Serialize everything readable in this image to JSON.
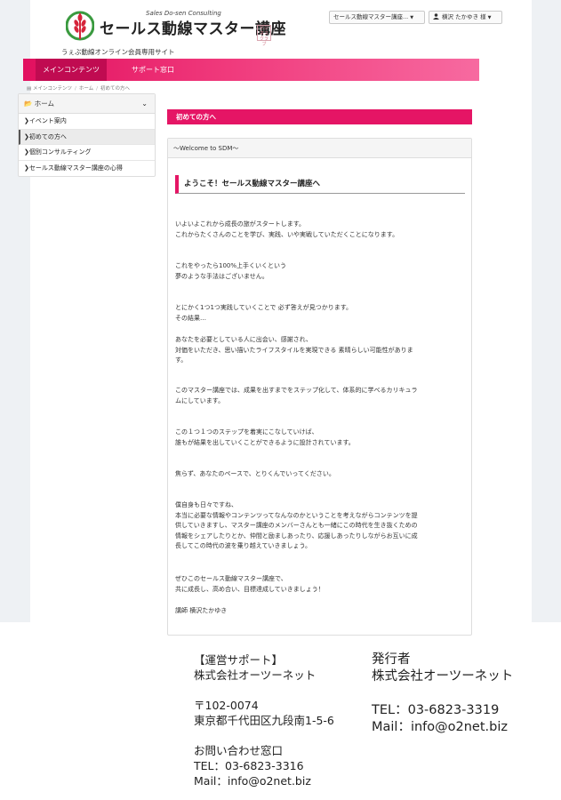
{
  "header": {
    "logo_subtitle": "Sales Do-sen Consulting",
    "logo_title": "セールス動線マスター講座",
    "logo_stamp": "ビジネスクラブ",
    "site_tagline": "うぇぶ動線オンライン会員専用サイト",
    "course_dropdown": "セールス動線マスター講座...",
    "user_menu": "横沢 たかゆき 様"
  },
  "nav": {
    "tabs": [
      {
        "label": "メインコンテンツ"
      },
      {
        "label": "サポート窓口"
      }
    ]
  },
  "breadcrumb": [
    "メインコンテンツ",
    "ホーム",
    "初めての方へ"
  ],
  "sidebar": {
    "header": "ホーム",
    "items": [
      {
        "label": "イベント案内"
      },
      {
        "label": "初めての方へ"
      },
      {
        "label": "個別コンサルティング"
      },
      {
        "label": "セールス動線マスター講座の心得"
      }
    ]
  },
  "main": {
    "heading": "初めての方へ",
    "panel_heading": "〜Welcome to SDM〜",
    "welcome_title": "ようこそ！セールス動線マスター講座へ",
    "paragraphs": [
      "いよいよこれから成長の旅がスタートします。\nこれからたくさんのことを学び、実践、いや実戦していただくことになります。",
      "これをやったら100%上手くいくという\n夢のような手法はございません。",
      "とにかく1つ1つ実践していくことで 必ず答えが見つかります。\nその結果…",
      "あなたを必要としている人に出会い、感謝され、\n対価をいただき、思い描いたライフスタイルを実現できる 素晴らしい可能性がありま\nす。",
      "このマスター講座では、成果を出すまでをステップ化して、体系的に学べるカリキュラ\nムにしています。",
      "この１つ１つのステップを着実にこなしていけば、\n誰もが結果を出していくことができるように設計されています。",
      "焦らず、あなたのペースで、とりくんでいってください。",
      "僕自身も日々ですね、\n本当に必要な情報やコンテンツってなんなのかということを考えながらコンテンツを提\n供していきますし、マスター講座のメンバーさんとも一緒にこの時代を生き抜くための\n情報をシェアしたりとか、仲間と励ましあったり、応援しあったりしながらお互いに成\n長してこの時代の波を乗り越えていきましょう。",
      "ぜひこのセールス動線マスター講座で、\n共に成長し、高め合い、目標達成していきましょう！",
      "講師 横沢たかゆき"
    ]
  },
  "footer": {
    "support_heading": "【運営サポート】",
    "support_company": "株式会社オーツーネット",
    "postal": "〒102-0074",
    "address": "東京都千代田区九段南1-5-6",
    "contact_heading": "お問い合わせ窓口",
    "contact_tel": "TEL：03-6823-3316",
    "contact_mail": "Mail：info@o2net.biz",
    "publisher_heading": "発行者",
    "publisher_company": "株式会社オーツーネット",
    "publisher_tel": "TEL：03-6823-3319",
    "publisher_mail": "Mail：info@o2net.biz"
  },
  "colors": {
    "accent": "#e51565",
    "logo_green": "#3a9a3f",
    "logo_red": "#d6253b"
  }
}
